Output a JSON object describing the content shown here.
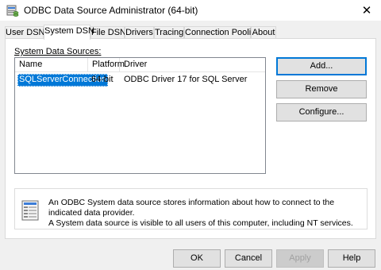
{
  "window": {
    "title": "ODBC Data Source Administrator (64-bit)",
    "close_glyph": "✕",
    "icon": "odbc-app-icon"
  },
  "tabs": [
    {
      "label": "User DSN",
      "active": false
    },
    {
      "label": "System DSN",
      "active": true
    },
    {
      "label": "File DSN",
      "active": false
    },
    {
      "label": "Drivers",
      "active": false
    },
    {
      "label": "Tracing",
      "active": false
    },
    {
      "label": "Connection Pooling",
      "active": false
    },
    {
      "label": "About",
      "active": false
    }
  ],
  "system_dsn": {
    "section_label": "System Data Sources:",
    "columns": [
      "Name",
      "Platform",
      "Driver"
    ],
    "rows": [
      {
        "name": "SQLServerConnection",
        "platform": "64-bit",
        "driver": "ODBC Driver 17 for SQL Server",
        "selected": true
      }
    ],
    "buttons": {
      "add": "Add...",
      "remove": "Remove",
      "configure": "Configure..."
    },
    "info": {
      "icon": "datasource-info-icon",
      "line1": "An ODBC System data source stores information about how to connect to the indicated data provider.",
      "line2": "A System data source is visible to all users of this computer, including NT services."
    }
  },
  "footer": {
    "ok": "OK",
    "cancel": "Cancel",
    "apply": "Apply",
    "help": "Help"
  },
  "colors": {
    "selection": "#0078d7",
    "default_button_border": "#0078d7"
  }
}
